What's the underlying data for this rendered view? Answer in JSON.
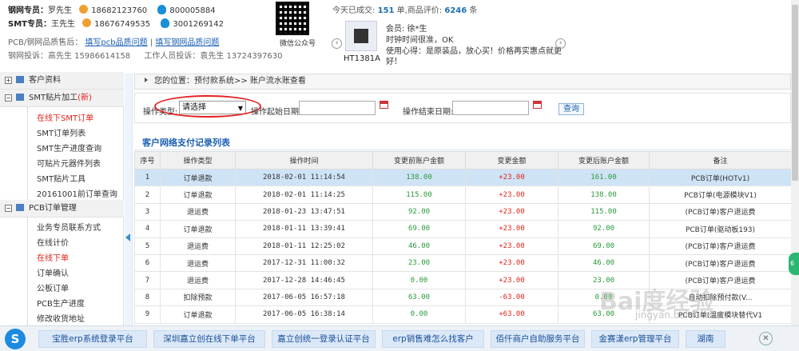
{
  "header": {
    "steel_rep": {
      "label": "钢网专员：",
      "name": "罗先生",
      "phone": "18682123760",
      "qq": "800005884"
    },
    "smt_rep": {
      "label": "SMT专员：",
      "name": "王先生",
      "phone": "18676749535",
      "qq": "3001269142"
    },
    "quality_label": "PCB/钢网品质售后：",
    "quality_link1": "填写pcb品质问题",
    "quality_sep": "|",
    "quality_link2": "填写钢网品质问题",
    "complaint_steel": "钢网投诉：高先生 15986614158",
    "complaint_staff": "工作人员投诉：袁先生 13724397630",
    "qr_label": "微信公众号",
    "today_prefix": "今天已成交:",
    "today_count": "151",
    "today_mid": "单,商品评价:",
    "review_count": "6246",
    "review_suffix": "条",
    "product_name": "HT1381A",
    "review_member": "会员: 徐*生",
    "review_line1": "时钟时间很准，OK",
    "review_line2": "使用心得：是原装品，放心买！价格再实惠点就更",
    "review_line3": "好！",
    "nav_prev": "‹",
    "nav_next": "›"
  },
  "sidebar": {
    "cat1": "客户资料",
    "cat2": "SMT贴片加工",
    "cat2_badge": "(新)",
    "smt_items": [
      "在线下SMT订单",
      "SMT订单列表",
      "SMT生产进度查询",
      "可贴片元器件列表",
      "SMT贴片工具",
      "20161001前订单查询"
    ],
    "cat3": "PCB订单管理",
    "pcb_items": [
      "业务专员联系方式",
      "在线计价",
      "在线下单",
      "订单确认",
      "公板订单",
      "PCB生产进度",
      "修改收货地址"
    ]
  },
  "breadcrumb": {
    "prefix": "您的位置：",
    "path": "预付款系统>> 账户流水账查看"
  },
  "filter": {
    "type_label": "操作类型:",
    "type_value": "请选择",
    "start_label": "操作起始日期:",
    "end_label": "操作结束日期:",
    "query_button": "查询"
  },
  "table": {
    "title": "客户网络支付记录列表",
    "headers": [
      "序号",
      "操作类型",
      "操作时间",
      "变更前账户金额",
      "变更金额",
      "变更后账户金额",
      "备注"
    ],
    "rows": [
      [
        "1",
        "订单退款",
        "2018-02-01 11:14:54",
        "138.00",
        "+23.00",
        "161.00",
        "PCB订单(HOTv1)"
      ],
      [
        "2",
        "订单退款",
        "2018-02-01 11:14:25",
        "115.00",
        "+23.00",
        "138.00",
        "PCB订单(电源模块V1)"
      ],
      [
        "3",
        "退运费",
        "2018-01-23 13:47:51",
        "92.00",
        "+23.00",
        "115.00",
        "(PCB订单)客户退运费"
      ],
      [
        "4",
        "订单退款",
        "2018-01-11 13:39:41",
        "69.00",
        "+23.00",
        "92.00",
        "PCB订单(驱动板193)"
      ],
      [
        "5",
        "退运费",
        "2018-01-11 12:25:02",
        "46.00",
        "+23.00",
        "69.00",
        "(PCB订单)客户退运费"
      ],
      [
        "6",
        "退运费",
        "2017-12-31 11:00:32",
        "23.00",
        "+23.00",
        "46.00",
        "(PCB订单)客户退运费"
      ],
      [
        "7",
        "退运费",
        "2017-12-28 14:46:45",
        "0.00",
        "+23.00",
        "23.00",
        "(PCB订单)客户退运费"
      ],
      [
        "8",
        "扣除预款",
        "2017-06-05 16:57:18",
        "63.00",
        "-63.00",
        "0.00",
        "自动扣除预付款(V..."
      ],
      [
        "9",
        "订单退款",
        "2017-06-05 16:38:14",
        "0.00",
        "+63.00",
        "63.00",
        "PCB订单(温度模块替代V1"
      ]
    ]
  },
  "bottom_bar": {
    "logo": "S",
    "links": [
      "宝胜erp系统登录平台",
      "深圳嘉立创在线下单平台",
      "嘉立创统一登录认证平台",
      "erp销售难怎么找客户",
      "佰仟商户自助服务平台",
      "金赛漾erp管理平台",
      "湖南"
    ],
    "close": "✕"
  },
  "watermark": {
    "main": "Bai度经验",
    "sub": "jingyan.baidu.com"
  },
  "colors": {
    "accent": "#1a5fb4",
    "positive": "#2a9a3a",
    "negative": "#e0241b",
    "highlight_row": "#cfe3f6"
  }
}
